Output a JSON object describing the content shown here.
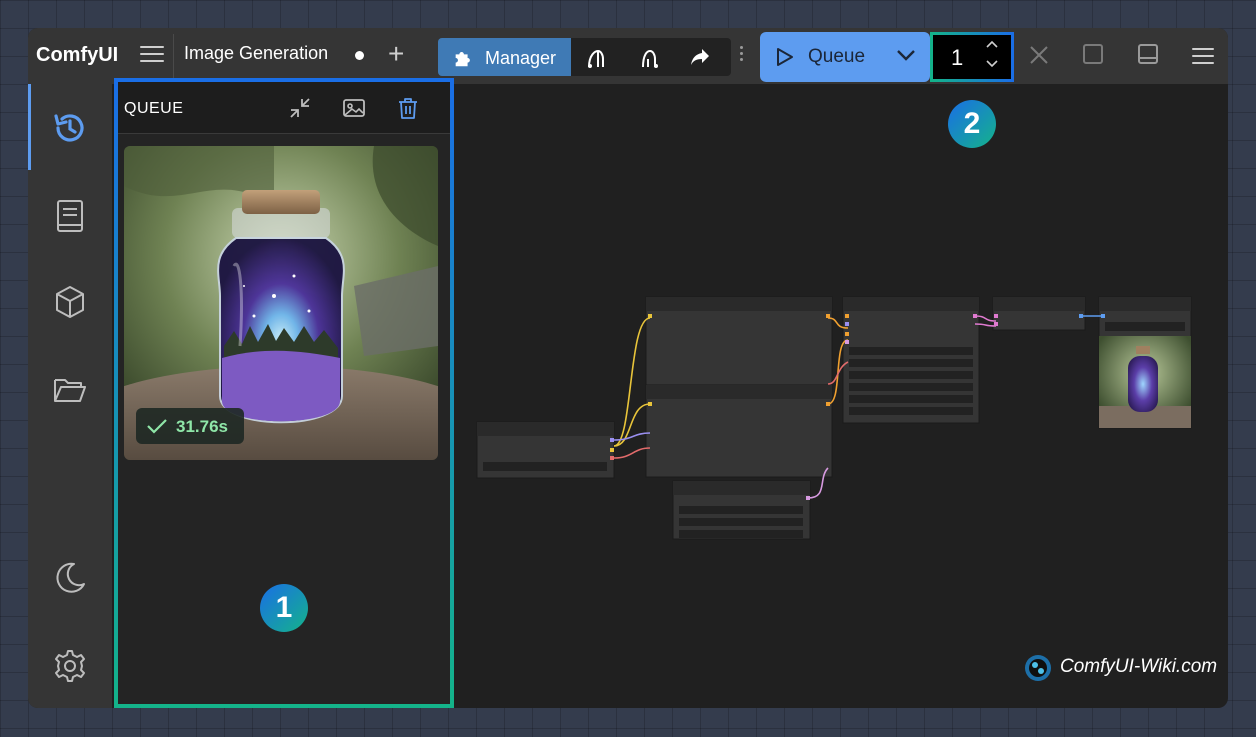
{
  "app": {
    "name": "ComfyUI"
  },
  "workflow": {
    "tab_label": "Image Generation"
  },
  "toolbar": {
    "manager_label": "Manager",
    "queue_label": "Queue",
    "batch_count": "1"
  },
  "queue_panel": {
    "title": "QUEUE",
    "items": [
      {
        "duration": "31.76s",
        "status": "completed"
      }
    ]
  },
  "markers": {
    "one": "1",
    "two": "2"
  },
  "watermark": {
    "text": "ComfyUI-Wiki.com"
  },
  "colors": {
    "accent": "#5d9cf0",
    "manager": "#3f7ab5",
    "highlight_start": "#1a6ee6",
    "highlight_end": "#14b38a",
    "success": "#8fe6a8"
  },
  "icons": [
    "menu-icon",
    "plus-icon",
    "puzzle-icon",
    "undo-icon",
    "redo-icon",
    "share-icon",
    "play-icon",
    "chevron-down-icon",
    "close-icon",
    "square-icon",
    "panel-icon",
    "history-icon",
    "book-icon",
    "cube-icon",
    "folder-icon",
    "moon-icon",
    "gear-icon",
    "collapse-icon",
    "image-icon",
    "trash-icon",
    "check-icon"
  ]
}
